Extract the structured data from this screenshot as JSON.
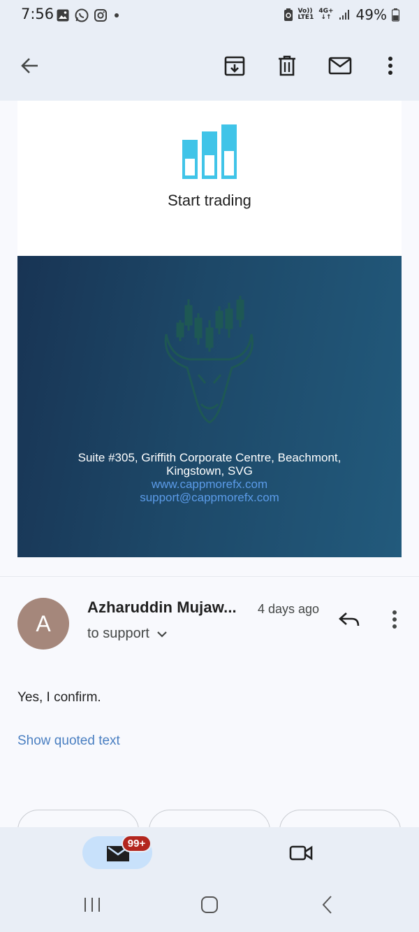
{
  "status_bar": {
    "time": "7:56",
    "notification_icons": [
      "gallery-icon",
      "whatsapp-icon",
      "instagram-icon",
      "dot-icon"
    ],
    "volte_label_top": "Vo))",
    "volte_label_bottom": "LTE1",
    "network_label": "4G+",
    "battery": "49%"
  },
  "toolbar": {
    "back_icon": "arrow-left-icon",
    "archive_icon": "archive-icon",
    "delete_icon": "trash-icon",
    "mark_unread_icon": "mail-icon",
    "more_icon": "more-vert-icon"
  },
  "email_content": {
    "cta_label": "Start trading",
    "address_line1": "Suite #305, Griffith Corporate Centre, Beachmont,",
    "address_line2": "Kingstown, SVG",
    "website": "www.cappmorefx.com",
    "support_email": "support@cappmorefx.com"
  },
  "message": {
    "avatar_letter": "A",
    "sender": "Azharuddin Mujaw...",
    "date": "4 days ago",
    "recipient": "to support",
    "body": "Yes, I confirm.",
    "show_quoted": "Show quoted text"
  },
  "bottom_nav": {
    "mail_badge": "99+",
    "tabs": [
      "mail-icon",
      "video-icon"
    ]
  },
  "colors": {
    "accent": "#c8e1fb",
    "badge": "#b3261e",
    "link": "#4a7fc1",
    "chart_icon": "#40c4e8",
    "banner": "#1d4868"
  }
}
